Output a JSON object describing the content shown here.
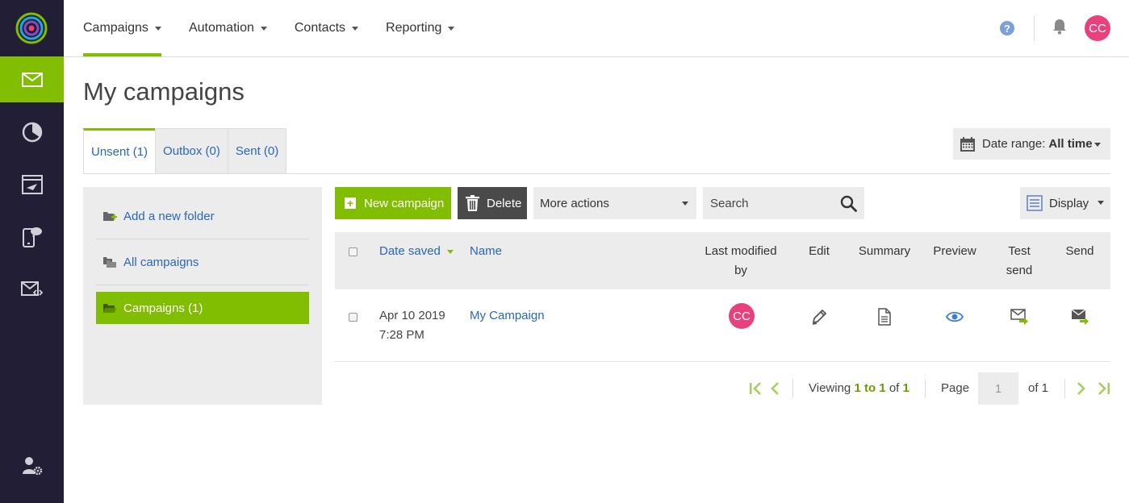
{
  "rail": {
    "items": [
      {
        "name": "campaigns-icon",
        "active": true
      },
      {
        "name": "reporting-pie-icon",
        "active": false
      },
      {
        "name": "automation-icon",
        "active": false
      },
      {
        "name": "sms-icon",
        "active": false
      },
      {
        "name": "transactional-email-icon",
        "active": false
      }
    ],
    "footer_icon": "user-settings-icon",
    "accent_color": "#81bd00",
    "background_color": "#211e36"
  },
  "topnav": {
    "menus": [
      "Campaigns",
      "Automation",
      "Contacts",
      "Reporting"
    ],
    "active_menu": "Campaigns",
    "user_initials": "CC",
    "avatar_color": "#e8417e"
  },
  "page": {
    "title": "My campaigns"
  },
  "tabs": [
    {
      "label": "Unsent (1)",
      "active": true
    },
    {
      "label": "Outbox (0)",
      "active": false
    },
    {
      "label": "Sent (0)",
      "active": false
    }
  ],
  "date_range": {
    "label": "Date range:",
    "value": "All time"
  },
  "folders": {
    "add_label": "Add a new folder",
    "all_label": "All campaigns",
    "items": [
      {
        "label": "Campaigns (1)",
        "active": true
      }
    ]
  },
  "toolbar": {
    "new_label": "New campaign",
    "delete_label": "Delete",
    "more_actions_label": "More actions",
    "search_placeholder": "Search",
    "display_label": "Display"
  },
  "table": {
    "columns": {
      "date_saved": "Date saved",
      "name": "Name",
      "last_modified_line1": "Last modified",
      "last_modified_line2": "by",
      "edit": "Edit",
      "summary": "Summary",
      "preview": "Preview",
      "test_send_line1": "Test",
      "test_send_line2": "send",
      "send": "Send"
    },
    "rows": [
      {
        "date": "Apr 10 2019",
        "time": "7:28 PM",
        "name": "My Campaign",
        "modified_by": "CC"
      }
    ]
  },
  "pagination": {
    "viewing_label": "Viewing",
    "from": "1",
    "to_label": "to",
    "to": "1",
    "of_label": "of",
    "total": "1",
    "page_label": "Page",
    "page_value": "1",
    "of_pages": "of 1"
  }
}
